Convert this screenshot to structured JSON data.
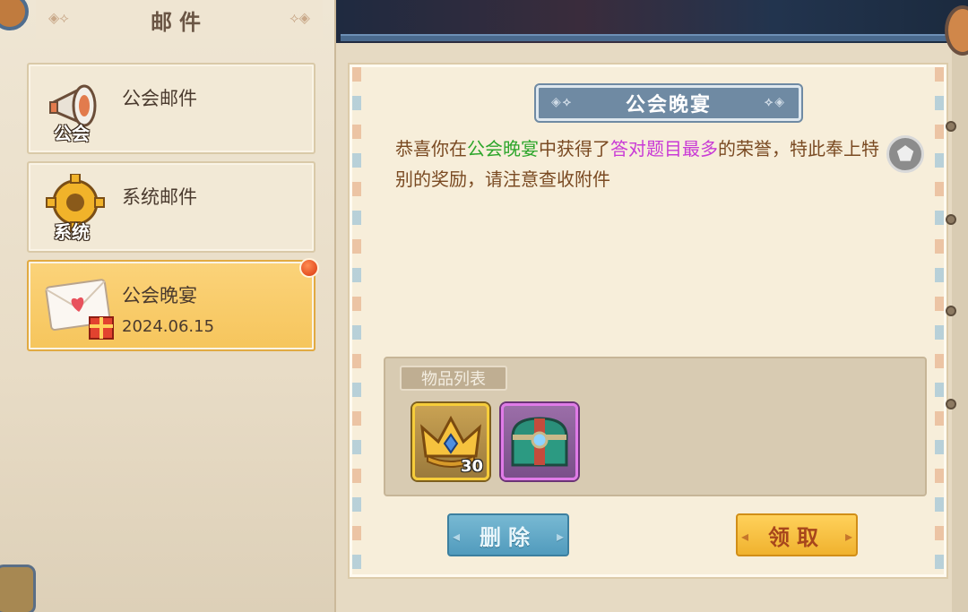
{
  "window": {
    "title": "邮件"
  },
  "mail_list": [
    {
      "title": "公会邮件",
      "icon": "megaphone-icon",
      "icon_label": "公会",
      "date": "",
      "unread": false,
      "selected": false
    },
    {
      "title": "系统邮件",
      "icon": "gear-icon",
      "icon_label": "系统",
      "date": "",
      "unread": false,
      "selected": false
    },
    {
      "title": "公会晚宴",
      "icon": "envelope-heart-icon",
      "icon_label": "",
      "date": "2024.06.15",
      "unread": true,
      "selected": true
    }
  ],
  "letter": {
    "title": "公会晚宴",
    "body": {
      "p1": "恭喜你在",
      "highlight1": "公会晚宴",
      "p2": "中获得了",
      "highlight2": "答对题目最多",
      "p3": "的荣誉，特此奉上特别的奖励，请注意查收附件"
    },
    "items_label": "物品列表",
    "items": [
      {
        "name": "crown-icon",
        "count": "30",
        "rarity": "gold"
      },
      {
        "name": "treasure-chest-icon",
        "count": "",
        "rarity": "purple"
      }
    ],
    "delete_label": "删除",
    "claim_label": "领取"
  },
  "colors": {
    "accent_gold": "#f6c55c",
    "title_blue": "#6f8aa3",
    "highlight_green": "#2ea62c",
    "highlight_purple": "#c93ad6",
    "unread_red": "#d9350e"
  }
}
